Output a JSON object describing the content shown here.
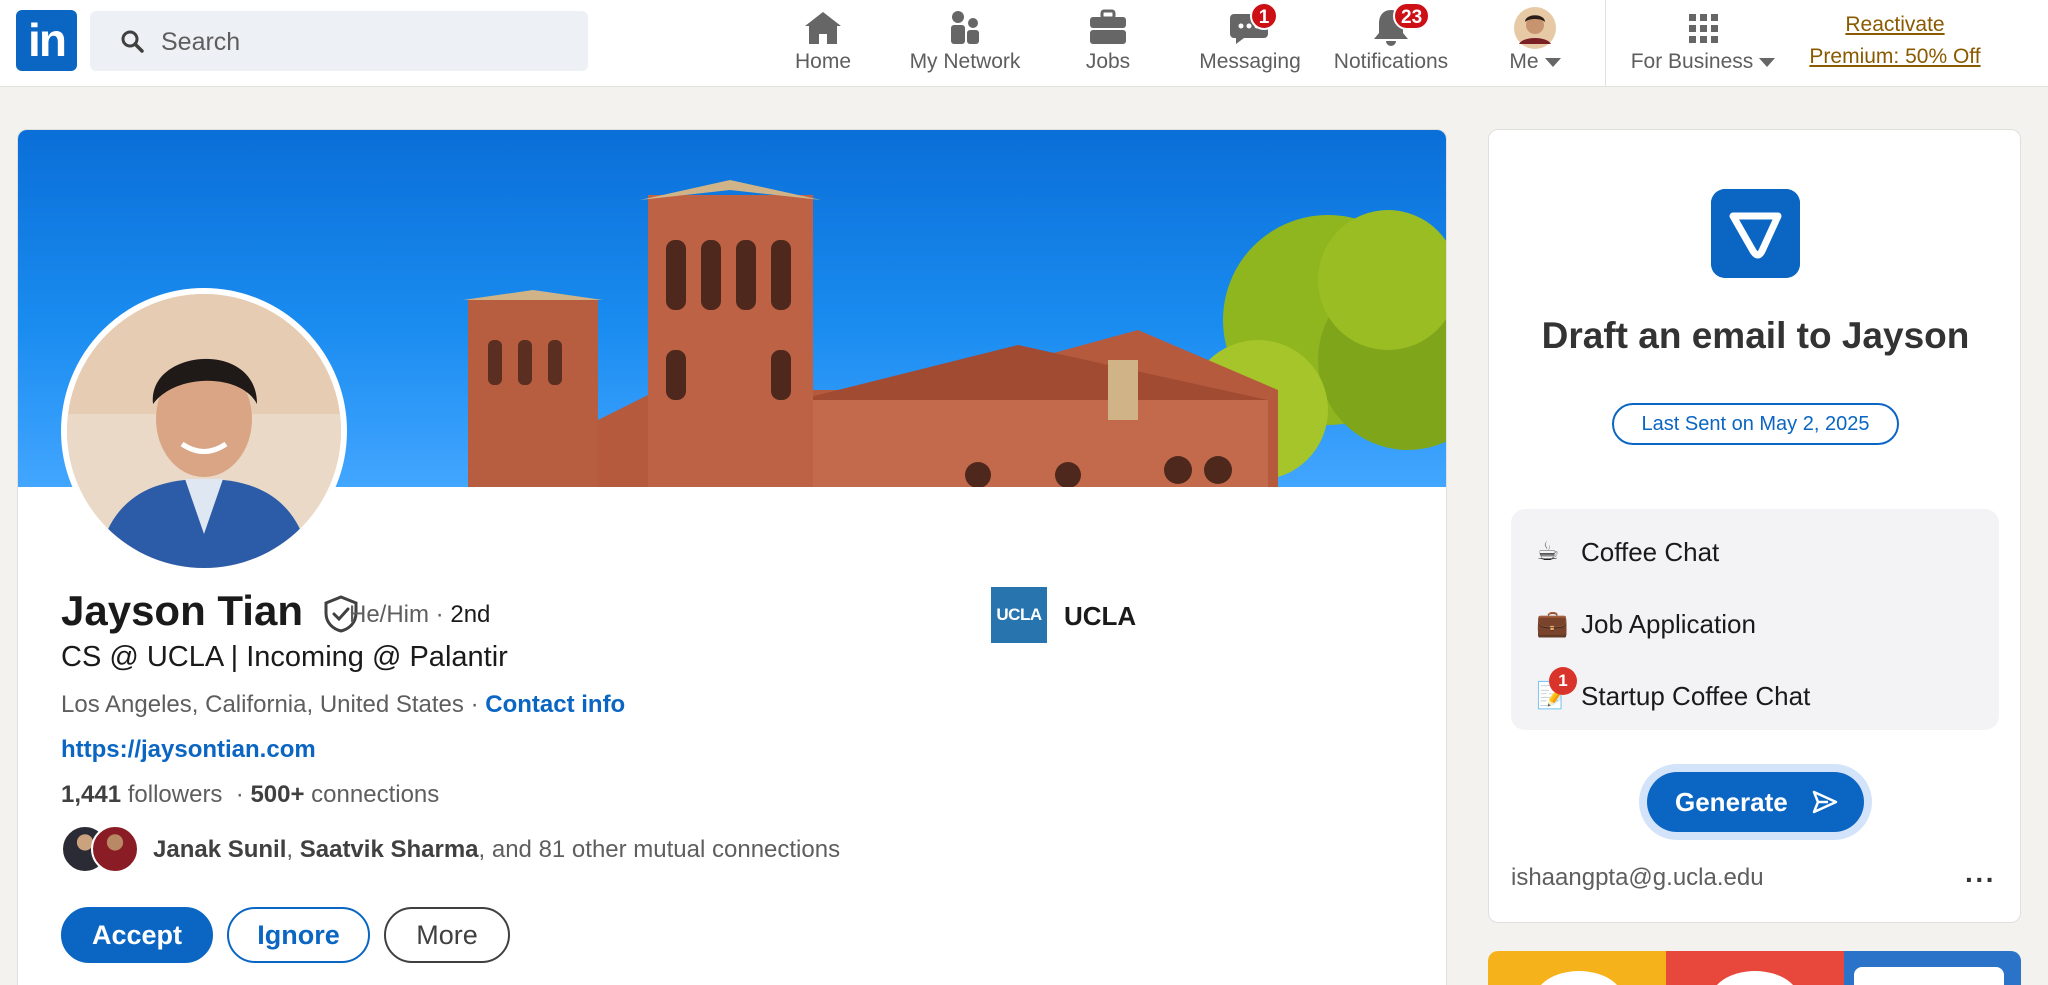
{
  "nav": {
    "logo_text": "in",
    "search_placeholder": "Search",
    "items": [
      {
        "label": "Home"
      },
      {
        "label": "My Network"
      },
      {
        "label": "Jobs"
      },
      {
        "label": "Messaging",
        "badge": "1"
      },
      {
        "label": "Notifications",
        "badge": "23"
      },
      {
        "label": "Me"
      },
      {
        "label": "For Business"
      }
    ],
    "premium_line1": "Reactivate",
    "premium_line2": "Premium: 50% Off"
  },
  "profile": {
    "name": "Jayson Tian",
    "pronouns": "He/Him",
    "degree": "2nd",
    "headline": "CS @ UCLA | Incoming @ Palantir",
    "location": "Los Angeles, California, United States",
    "contact_label": "Contact info",
    "website": "https://jaysontian.com",
    "followers_count": "1,441",
    "followers_label": "followers",
    "connections_count": "500+",
    "connections_label": "connections",
    "mutual_name_1": "Janak Sunil",
    "mutual_name_2": "Saatvik Sharma",
    "mutual_rest": ", and 81 other mutual connections",
    "school_logo_text": "UCLA",
    "school_name": "UCLA",
    "buttons": {
      "accept": "Accept",
      "ignore": "Ignore",
      "more": "More"
    }
  },
  "email_panel": {
    "title": "Draft an email to Jayson",
    "last_sent": "Last Sent on May 2, 2025",
    "templates": [
      {
        "icon": "coffee-icon",
        "glyph": "☕",
        "label": "Coffee Chat"
      },
      {
        "icon": "briefcase-icon",
        "glyph": "💼",
        "label": "Job Application"
      },
      {
        "icon": "memo-icon",
        "glyph": "📝",
        "label": "Startup Coffee Chat",
        "badge": "1"
      }
    ],
    "generate_label": "Generate",
    "sender_email": "ishaangpta@g.ucla.edu",
    "more_glyph": "···"
  },
  "colors": {
    "brand": "#0a66c2",
    "badge": "#cc1016",
    "premium": "#8a5a00"
  }
}
